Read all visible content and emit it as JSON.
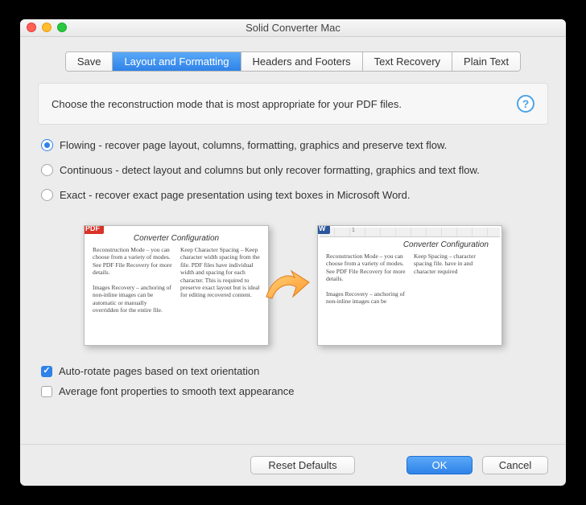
{
  "window": {
    "title": "Solid Converter Mac"
  },
  "tabs": [
    {
      "label": "Save"
    },
    {
      "label": "Layout and Formatting",
      "active": true
    },
    {
      "label": "Headers and Footers"
    },
    {
      "label": "Text Recovery"
    },
    {
      "label": "Plain Text"
    }
  ],
  "info": {
    "text": "Choose the reconstruction mode that is most appropriate for your PDF files.",
    "help_symbol": "?"
  },
  "modes": {
    "selected": 0,
    "options": [
      "Flowing - recover page layout, columns, formatting, graphics and preserve text flow.",
      "Continuous - detect layout and columns but only recover formatting, graphics and text flow.",
      "Exact - recover exact page presentation using text boxes in Microsoft Word."
    ]
  },
  "preview": {
    "source_badge": "PDF",
    "target_badge": "W",
    "doc_title": "Converter Configuration",
    "ruler_text": "1",
    "col1": "Reconstruction Mode – you can choose from a variety of modes. See PDF File Recovery for more details.\n\nImages Recovery – anchoring of non-inline images can be automatic or manually overridden for the entire file.",
    "col2": "Keep Character Spacing – Keep character width spacing from the file. PDF files have individual width and spacing for each character. This is required to preserve exact layout but is ideal for editing recovered content.",
    "r_col1": "Reconstruction Mode – you can choose from a variety of modes. See PDF File Recovery for more details.\n\nImages Recovery – anchoring of non-inline images can be",
    "r_col2": "Keep Spacing – character spacing file. have in and character required"
  },
  "checkboxes": {
    "auto_rotate": {
      "label": "Auto-rotate pages based on text orientation",
      "checked": true
    },
    "avg_font": {
      "label": "Average font properties to smooth text appearance",
      "checked": false
    }
  },
  "buttons": {
    "reset": "Reset Defaults",
    "ok": "OK",
    "cancel": "Cancel"
  }
}
